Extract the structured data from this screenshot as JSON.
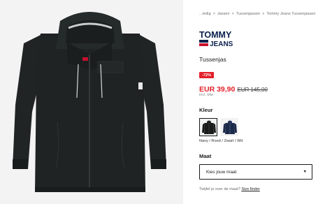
{
  "breadcrumb": {
    "items": [
      "...ledig",
      "Jassen",
      "Tussenjassen",
      "Tommy Jeans Tussenjassen"
    ],
    "separator": ">"
  },
  "brand": {
    "line1": "TOMMY",
    "line2": "JEANS",
    "flag_colors": [
      "#0a1f4d",
      "#c8102e"
    ]
  },
  "product": {
    "name": "Tussenjas"
  },
  "pricing": {
    "discount": "-72%",
    "price": "EUR 39,90",
    "old_price": "EUR 145,00",
    "vat_note": "incl. btw",
    "sale_color": "#e3202a"
  },
  "color_section": {
    "label": "Kleur",
    "swatches": [
      {
        "name": "black",
        "selected": true,
        "color": "#1a1c1c"
      },
      {
        "name": "navy",
        "selected": false,
        "color": "#1c2a4a"
      }
    ],
    "selected_text": "Navy / Rood / Zwart / Wit"
  },
  "size_section": {
    "label": "Maat",
    "select_placeholder": "Kies jouw maat"
  },
  "size_help": {
    "question": "Twijfel je over de maat?",
    "link": "Size finder"
  }
}
